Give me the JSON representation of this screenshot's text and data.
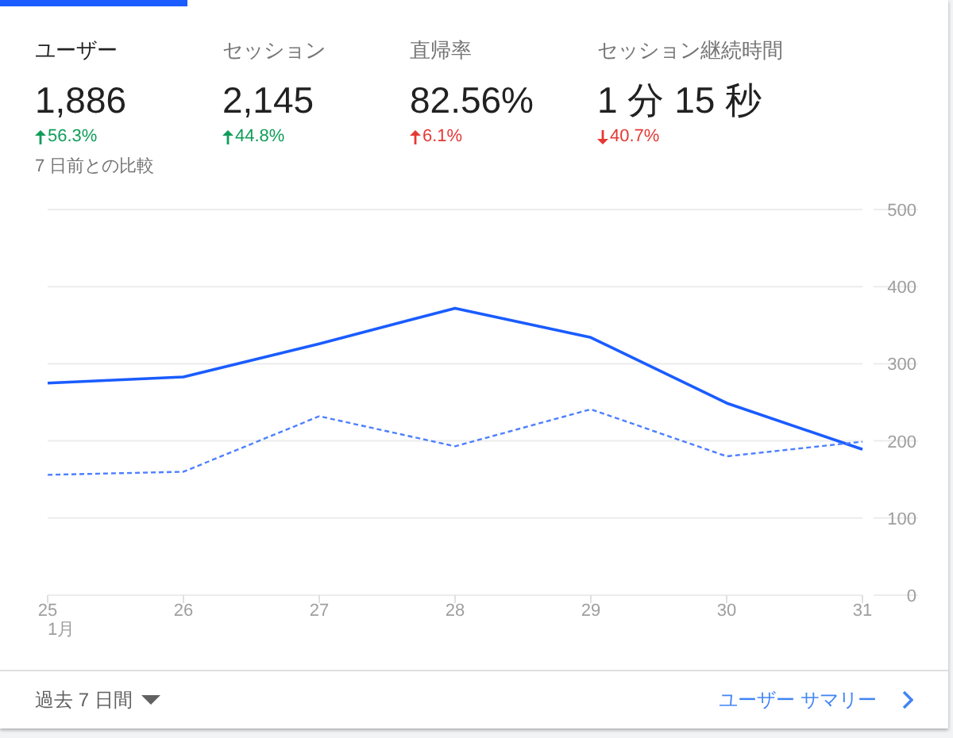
{
  "metrics": [
    {
      "label": "ユーザー",
      "value": "1,886",
      "change": "56.3%",
      "kind": "rise",
      "positive": true,
      "selected": true
    },
    {
      "label": "セッション",
      "value": "2,145",
      "change": "44.8%",
      "kind": "rise",
      "positive": true,
      "selected": false
    },
    {
      "label": "直帰率",
      "value": "82.56%",
      "change": "6.1%",
      "kind": "rise",
      "positive": false,
      "selected": false
    },
    {
      "label": "セッション継続時間",
      "value": "1 分 15 秒",
      "change": "40.7%",
      "kind": "fall",
      "positive": false,
      "selected": false
    }
  ],
  "comparison_note": "7 日前との比較",
  "chart_data": {
    "type": "line",
    "categories": [
      "25",
      "26",
      "27",
      "28",
      "29",
      "30",
      "31"
    ],
    "xlabel": "1月",
    "ylim": [
      0,
      500
    ],
    "yticks": [
      0,
      100,
      200,
      300,
      400,
      500
    ],
    "grid": true,
    "series": [
      {
        "color": "#1a5cff",
        "line_style": "solid",
        "values": [
          275,
          283,
          326,
          372,
          334,
          249,
          189
        ]
      },
      {
        "color": "#4d7fff",
        "line_style": "dashed",
        "values": [
          156,
          160,
          232,
          193,
          241,
          180,
          199
        ]
      }
    ]
  },
  "footer": {
    "date_range": "過去 7 日間",
    "link": "ユーザー サマリー"
  }
}
